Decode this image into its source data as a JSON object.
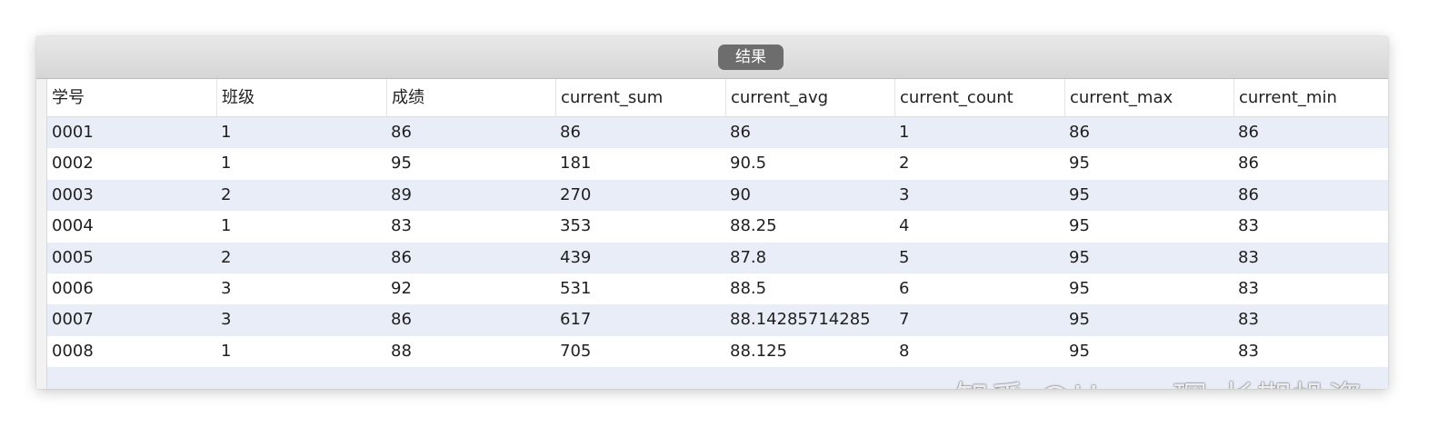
{
  "window": {
    "title": "结果"
  },
  "table": {
    "columns": [
      "学号",
      "班级",
      "成绩",
      "current_sum",
      "current_avg",
      "current_count",
      "current_max",
      "current_min"
    ],
    "rows": [
      [
        "0001",
        "1",
        "86",
        "86",
        "86",
        "1",
        "86",
        "86"
      ],
      [
        "0002",
        "1",
        "95",
        "181",
        "90.5",
        "2",
        "95",
        "86"
      ],
      [
        "0003",
        "2",
        "89",
        "270",
        "90",
        "3",
        "95",
        "86"
      ],
      [
        "0004",
        "1",
        "83",
        "353",
        "88.25",
        "4",
        "95",
        "83"
      ],
      [
        "0005",
        "2",
        "86",
        "439",
        "87.8",
        "5",
        "95",
        "83"
      ],
      [
        "0006",
        "3",
        "92",
        "531",
        "88.5",
        "6",
        "95",
        "83"
      ],
      [
        "0007",
        "3",
        "86",
        "617",
        "88.14285714285",
        "7",
        "95",
        "83"
      ],
      [
        "0008",
        "1",
        "88",
        "705",
        "88.125",
        "8",
        "95",
        "83"
      ]
    ]
  },
  "watermark": {
    "text": "知乎 @Harry琛-长期投资"
  },
  "colors": {
    "row_stripe": "#e9edf8",
    "title_pill": "#6d6d6d",
    "titlebar": "#dcdcdc"
  }
}
